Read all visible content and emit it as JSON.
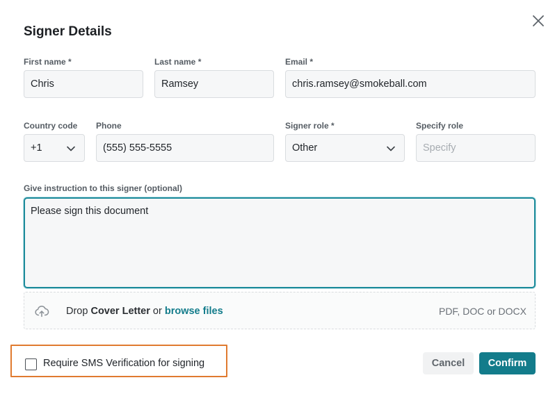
{
  "dialog": {
    "title": "Signer Details",
    "close_icon": "close-icon"
  },
  "fields": {
    "first_name": {
      "label": "First name *",
      "value": "Chris"
    },
    "last_name": {
      "label": "Last name *",
      "value": "Ramsey"
    },
    "email": {
      "label": "Email *",
      "value": "chris.ramsey@smokeball.com"
    },
    "country_code": {
      "label": "Country code",
      "value": "+1"
    },
    "phone": {
      "label": "Phone",
      "value": "(555) 555-5555"
    },
    "signer_role": {
      "label": "Signer role *",
      "value": "Other"
    },
    "specify_role": {
      "label": "Specify role",
      "placeholder": "Specify"
    },
    "instruction": {
      "label": "Give instruction to this signer (optional)",
      "value": "Please sign this document"
    }
  },
  "dropzone": {
    "prefix": "Drop ",
    "bold": "Cover Letter",
    "middle": " or ",
    "link": "browse files",
    "formats": "PDF, DOC or DOCX",
    "icon": "cloud-upload-icon"
  },
  "sms": {
    "label": "Require SMS Verification for signing",
    "checked": false,
    "highlight_color": "#e07a2f"
  },
  "buttons": {
    "cancel": "Cancel",
    "confirm": "Confirm"
  },
  "colors": {
    "accent": "#137c8b",
    "focus_border": "#1b8a9a"
  }
}
